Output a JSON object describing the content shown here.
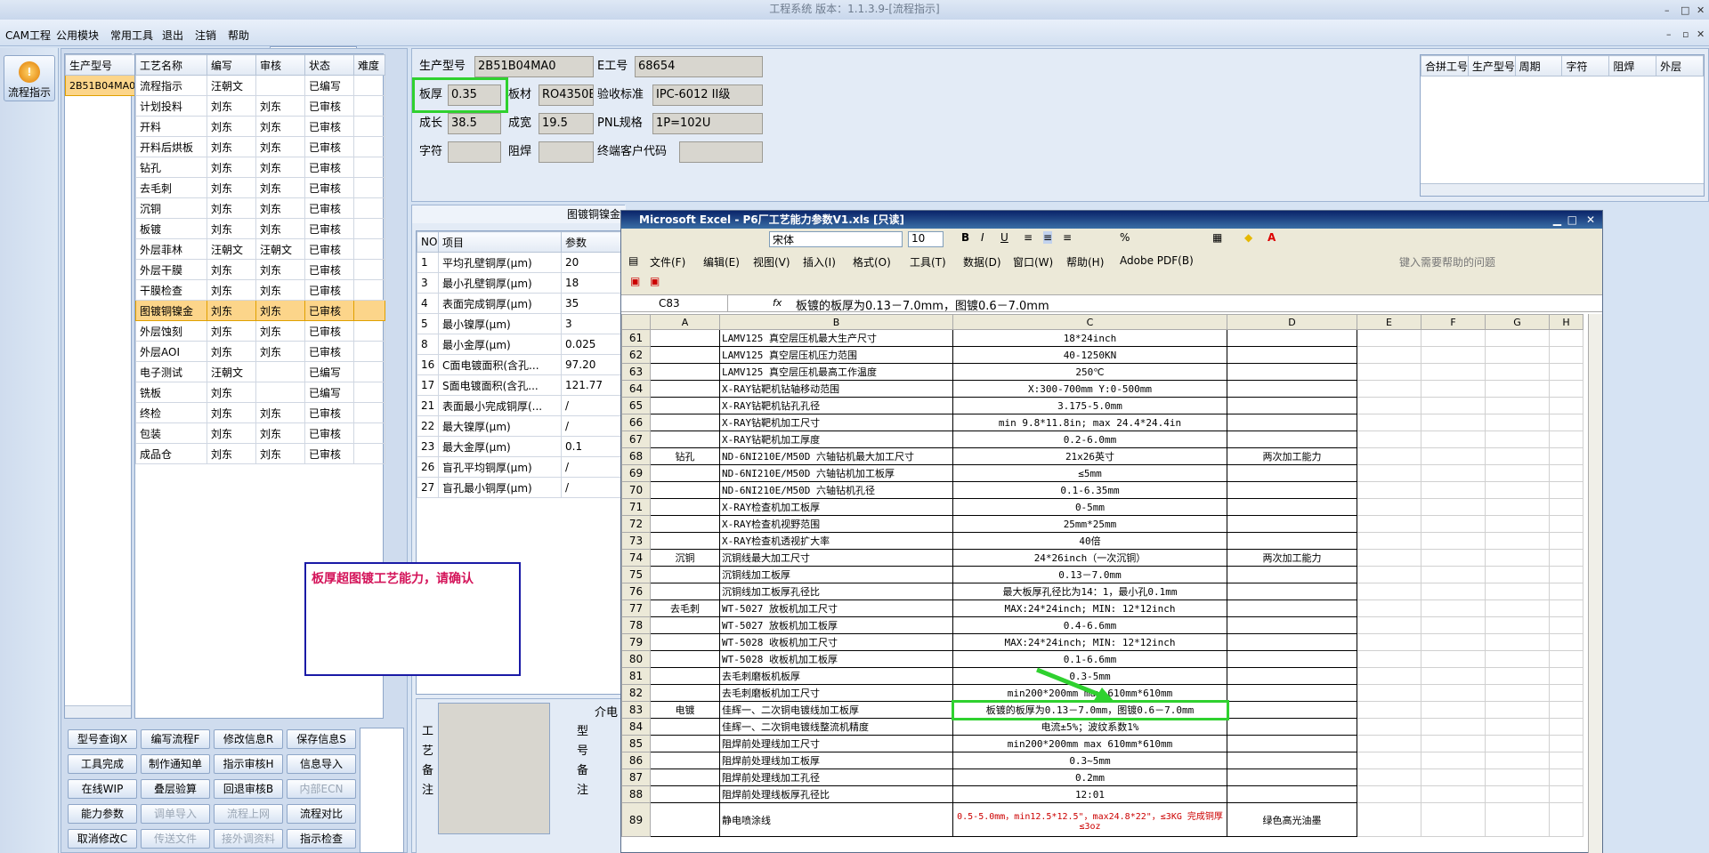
{
  "app_title": "工程系统 版本：1.1.3.9-[流程指示]",
  "menu": [
    "CAM工程",
    "公用模块",
    "常用工具",
    "退出",
    "注销",
    "帮助"
  ],
  "nav": {
    "label": "流程指示",
    "icon": "flow-icon"
  },
  "part_table": {
    "header": "生产型号",
    "row": "2B51B04MA0"
  },
  "flow_table": {
    "headers": [
      "工艺名称",
      "编写",
      "审核",
      "状态",
      "难度"
    ],
    "rows": [
      [
        "流程指示",
        "汪朝文",
        "",
        "已编写"
      ],
      [
        "计划投料",
        "刘东",
        "刘东",
        "已审核"
      ],
      [
        "开料",
        "刘东",
        "刘东",
        "已审核"
      ],
      [
        "开料后烘板",
        "刘东",
        "刘东",
        "已审核"
      ],
      [
        "钻孔",
        "刘东",
        "刘东",
        "已审核"
      ],
      [
        "去毛刺",
        "刘东",
        "刘东",
        "已审核"
      ],
      [
        "沉铜",
        "刘东",
        "刘东",
        "已审核"
      ],
      [
        "板镀",
        "刘东",
        "刘东",
        "已审核"
      ],
      [
        "外层菲林",
        "汪朝文",
        "汪朝文",
        "已审核"
      ],
      [
        "外层干膜",
        "刘东",
        "刘东",
        "已审核"
      ],
      [
        "干膜检查",
        "刘东",
        "刘东",
        "已审核"
      ],
      [
        "图镀铜镍金",
        "刘东",
        "刘东",
        "已审核"
      ],
      [
        "外层蚀刻",
        "刘东",
        "刘东",
        "已审核"
      ],
      [
        "外层AOI",
        "刘东",
        "刘东",
        "已审核"
      ],
      [
        "电子测试",
        "汪朝文",
        "",
        "已编写"
      ],
      [
        "铣板",
        "刘东",
        "",
        "已编写"
      ],
      [
        "终检",
        "刘东",
        "刘东",
        "已审核"
      ],
      [
        "包装",
        "刘东",
        "刘东",
        "已审核"
      ],
      [
        "成品仓",
        "刘东",
        "刘东",
        "已审核"
      ]
    ],
    "selected": 11
  },
  "info": {
    "part_label": "生产型号",
    "part": "2B51B04MA0",
    "eno_label": "E工号",
    "eno": "68654",
    "thick_label": "板厚",
    "thick": "0.35",
    "mat_label": "板材",
    "mat": "RO4350B",
    "std_label": "验收标准",
    "std": "IPC-6012 II级",
    "len_label": "成长",
    "len": "38.5",
    "wid_label": "成宽",
    "wid": "19.5",
    "pnl_label": "PNL规格",
    "pnl": "1P=102U",
    "char_label": "字符",
    "mask_label": "阻焊",
    "cust_label": "终端客户代码"
  },
  "merge_table": {
    "headers": [
      "合拼工号",
      "生产型号",
      "周期",
      "字符",
      "阻焊",
      "外层"
    ]
  },
  "param_panel": {
    "title": "图镀铜镍金",
    "headers": [
      "NO",
      "项目",
      "参数"
    ],
    "rows": [
      [
        "1",
        "平均孔壁铜厚(μm)",
        "20"
      ],
      [
        "3",
        "最小孔壁铜厚(μm)",
        "18"
      ],
      [
        "4",
        "表面完成铜厚(μm)",
        "35"
      ],
      [
        "5",
        "最小镍厚(μm)",
        "3"
      ],
      [
        "8",
        "最小金厚(μm)",
        "0.025"
      ],
      [
        "16",
        "C面电镀面积(含孔...",
        "97.20"
      ],
      [
        "17",
        "S面电镀面积(含孔...",
        "121.77"
      ],
      [
        "21",
        "表面最小完成铜厚(...",
        "/"
      ],
      [
        "22",
        "最大镍厚(μm)",
        "/"
      ],
      [
        "23",
        "最大金厚(μm)",
        "0.1"
      ],
      [
        "26",
        "盲孔平均铜厚(μm)",
        "/"
      ],
      [
        "27",
        "盲孔最小铜厚(μm)",
        "/"
      ]
    ]
  },
  "notes": {
    "process": "工艺备注",
    "model": "型号备注",
    "intro": "介电"
  },
  "warning": "板厚超图镀工艺能力，请确认",
  "buttons": [
    [
      "型号查询X",
      "编写流程F",
      "修改信息R",
      "保存信息S"
    ],
    [
      "工具完成",
      "制作通知单",
      "指示审核H",
      "信息导入"
    ],
    [
      "在线WIP",
      "叠层验算",
      "回退审核B",
      "内部ECN"
    ],
    [
      "能力参数",
      "调单导入",
      "流程上网",
      "流程对比"
    ],
    [
      "取消修改C",
      "传送文件",
      "接外调资料",
      "指示检查"
    ]
  ],
  "disabled_buttons": [
    "内部ECN",
    "调单导入",
    "流程上网",
    "传送文件",
    "接外调资料"
  ],
  "excel": {
    "title": "Microsoft Excel - P6厂工艺能力参数V1.xls  [只读]",
    "font": "宋体",
    "size": "10",
    "menu": [
      "文件(F)",
      "编辑(E)",
      "视图(V)",
      "插入(I)",
      "格式(O)",
      "工具(T)",
      "数据(D)",
      "窗口(W)",
      "帮助(H)",
      "Adobe PDF(B)"
    ],
    "help_box": "键入需要帮助的问题",
    "cell_ref": "C83",
    "fx": "fx",
    "formula": "板镀的板厚为0.13－7.0mm，图镀0.6－7.0mm",
    "cols": [
      "A",
      "B",
      "C",
      "D",
      "E",
      "F",
      "G",
      "H"
    ],
    "rows": [
      [
        "61",
        "",
        "LAMV125 真空层压机最大生产尺寸",
        "18*24inch",
        ""
      ],
      [
        "62",
        "",
        "LAMV125 真空层压机压力范围",
        "40-1250KN",
        ""
      ],
      [
        "63",
        "",
        "LAMV125 真空层压机最高工作温度",
        "250℃",
        ""
      ],
      [
        "64",
        "",
        "X-RAY钻靶机钻轴移动范围",
        "X:300-700mm  Y:0-500mm",
        ""
      ],
      [
        "65",
        "",
        "X-RAY钻靶机钻孔孔径",
        "3.175-5.0mm",
        ""
      ],
      [
        "66",
        "",
        "X-RAY钻靶机加工尺寸",
        "min 9.8*11.8in; max 24.4*24.4in",
        ""
      ],
      [
        "67",
        "",
        "X-RAY钻靶机加工厚度",
        "0.2-6.0mm",
        ""
      ],
      [
        "68",
        "钻孔",
        "ND-6NI210E/M50D 六轴钻机最大加工尺寸",
        "21x26英寸",
        "两次加工能力"
      ],
      [
        "69",
        "",
        "ND-6NI210E/M50D 六轴钻机加工板厚",
        "≤5mm",
        ""
      ],
      [
        "70",
        "",
        "ND-6NI210E/M50D 六轴钻机孔径",
        "0.1-6.35mm",
        ""
      ],
      [
        "71",
        "",
        "X-RAY检查机加工板厚",
        "0-5mm",
        ""
      ],
      [
        "72",
        "",
        "X-RAY检查机视野范围",
        "25mm*25mm",
        ""
      ],
      [
        "73",
        "",
        "X-RAY检查机透视扩大率",
        "40倍",
        ""
      ],
      [
        "74",
        "沉铜",
        "沉铜线最大加工尺寸",
        "24*26inch（一次沉铜）",
        "两次加工能力"
      ],
      [
        "75",
        "",
        "沉铜线加工板厚",
        "0.13－7.0mm",
        ""
      ],
      [
        "76",
        "",
        "沉铜线加工板厚孔径比",
        "最大板厚孔径比为14：1，最小孔0.1mm",
        ""
      ],
      [
        "77",
        "去毛刺",
        "WT-5027 放板机加工尺寸",
        "MAX:24*24inch; MIN: 12*12inch",
        ""
      ],
      [
        "78",
        "",
        "WT-5027 放板机加工板厚",
        "0.4-6.6mm",
        ""
      ],
      [
        "79",
        "",
        "WT-5028 收板机加工尺寸",
        "MAX:24*24inch; MIN: 12*12inch",
        ""
      ],
      [
        "80",
        "",
        "WT-5028 收板机加工板厚",
        "0.1-6.6mm",
        ""
      ],
      [
        "81",
        "",
        "去毛刺磨板机板厚",
        "0.3-5mm",
        ""
      ],
      [
        "82",
        "",
        "去毛刺磨板机加工尺寸",
        "min200*200mm  max 610mm*610mm",
        ""
      ],
      [
        "83",
        "电镀",
        "佳辉一、二次铜电镀线加工板厚",
        "板镀的板厚为0.13－7.0mm，图镀0.6－7.0mm",
        ""
      ],
      [
        "84",
        "",
        "佳辉一、二次铜电镀线整流机精度",
        "电流±5%；波纹系数1%",
        ""
      ],
      [
        "85",
        "",
        "阻焊前处理线加工尺寸",
        "min200*200mm  max 610mm*610mm",
        ""
      ],
      [
        "86",
        "",
        "阻焊前处理线加工板厚",
        "0.3~5mm",
        ""
      ],
      [
        "87",
        "",
        "阻焊前处理线加工孔径",
        "0.2mm",
        ""
      ],
      [
        "88",
        "",
        "阻焊前处理线板厚孔径比",
        "12:01",
        ""
      ],
      [
        "89",
        "",
        "静电喷涂线",
        "0.5-5.0mm，min12.5*12.5\"，max24.8*22\"，≤3KG 完成铜厚≤3oz",
        "绿色高光油墨"
      ]
    ]
  }
}
